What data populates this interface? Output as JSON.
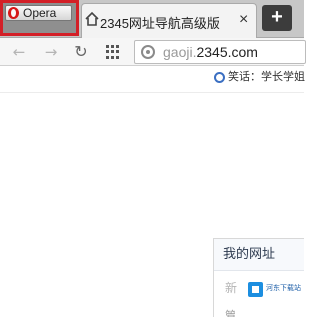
{
  "browser": {
    "menu_label": "Opera"
  },
  "tab": {
    "title": "2345网址导航高级版",
    "close_label": "×"
  },
  "new_tab": {
    "label": "+"
  },
  "address_bar": {
    "subdomain": "gaoji.",
    "domain": "2345.com"
  },
  "newsbar": {
    "text": "笑话：学长学姐"
  },
  "panel": {
    "title": "我的网址",
    "item_first": "新",
    "item_second": "管"
  },
  "watermark": {
    "text": "河东下载站"
  },
  "colors": {
    "highlight": "#d31f27",
    "tabbar": "#c7c7c7"
  }
}
